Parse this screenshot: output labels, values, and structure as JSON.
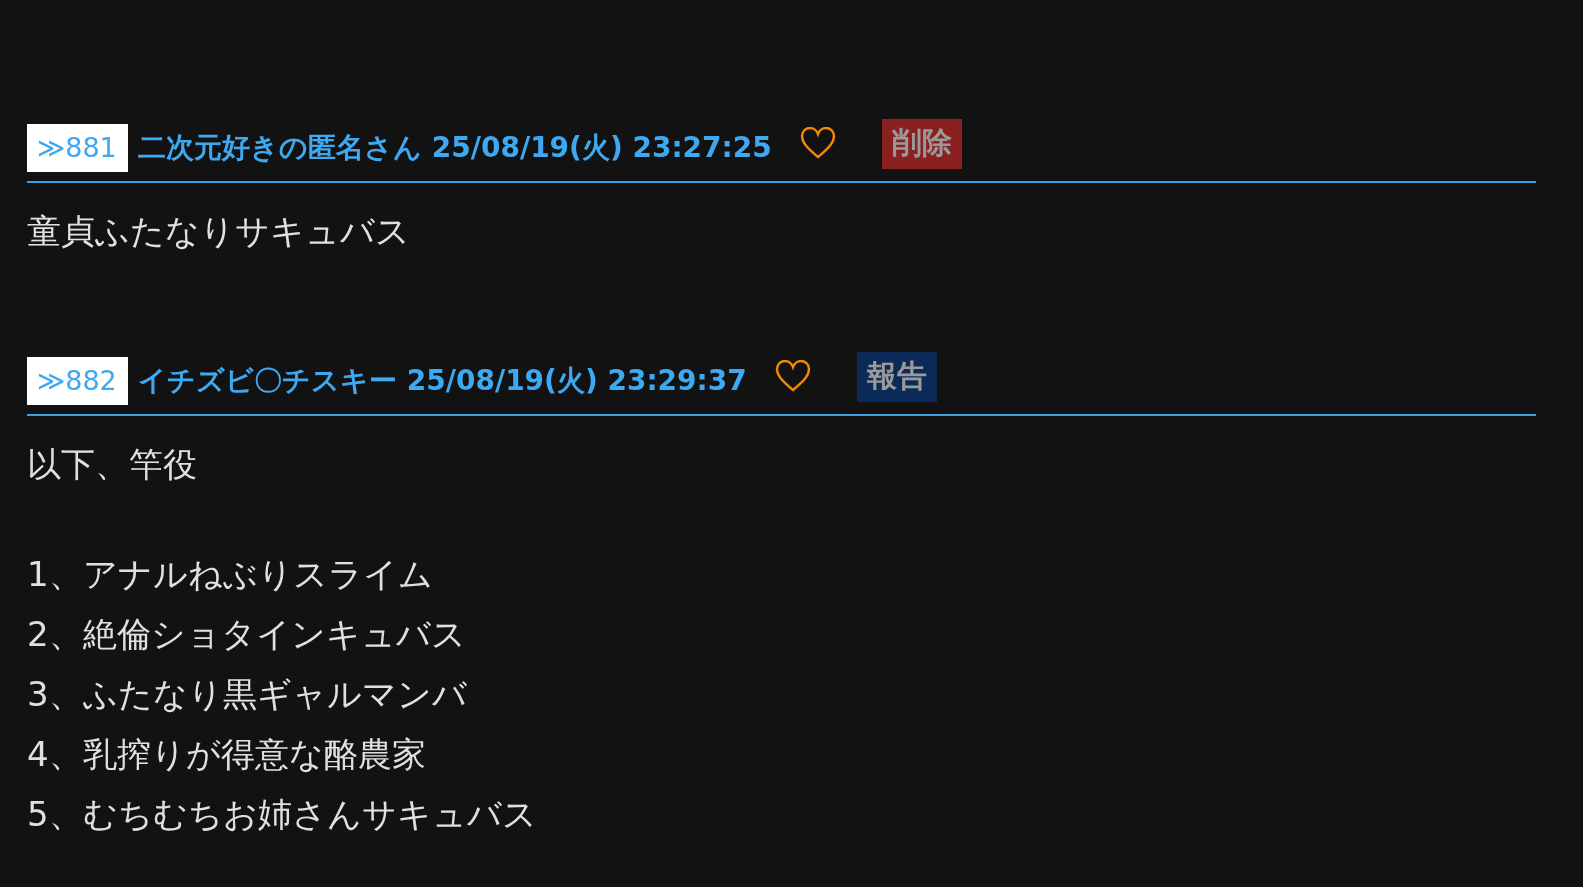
{
  "posts": [
    {
      "number": "≫881",
      "name": "二次元好きの匿名さん",
      "date": "25/08/19(火) 23:27:25",
      "action": {
        "label": "削除",
        "kind": "delete"
      },
      "paragraphs": [
        [
          "童貞ふたなりサキュバス"
        ]
      ]
    },
    {
      "number": "≫882",
      "name": "イチズビ〇チスキー",
      "date": "25/08/19(火) 23:29:37",
      "action": {
        "label": "報告",
        "kind": "report"
      },
      "paragraphs": [
        [
          "以下、竿役"
        ],
        [
          "1、アナルねぶりスライム",
          "2、絶倫ショタインキュバス",
          "3、ふたなり黒ギャルマンバ",
          "4、乳搾りが得意な酪農家",
          "5、むちむちお姉さんサキュバス"
        ]
      ]
    }
  ]
}
